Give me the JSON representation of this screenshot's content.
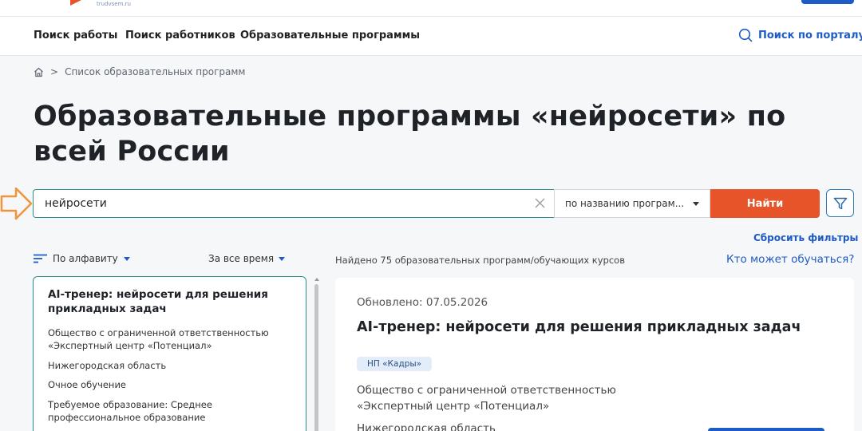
{
  "header": {
    "site_url": "trudvsem.ru",
    "accent_color": "#e8542a",
    "brand_color": "#1e5bc6"
  },
  "nav": {
    "items": [
      {
        "label": "Поиск работы"
      },
      {
        "label": "Поиск работников"
      },
      {
        "label": "Образовательные программы"
      }
    ],
    "search_label": "Поиск по порталу",
    "search_icon": "search-icon"
  },
  "breadcrumb": {
    "home_icon": "home-icon",
    "separator": ">",
    "current": "Список образовательных программ"
  },
  "page_title": "Образовательные программы «нейросети» по всей России",
  "search": {
    "value": "нейросети",
    "mode_selected": "по названию програм...",
    "submit_label": "Найти",
    "filter_icon": "filter-icon"
  },
  "reset_filters": "Сбросить фильтры",
  "sort": {
    "label": "По алфавиту",
    "period": "За все время"
  },
  "results_found": "Найдено 75 образовательных программ/обучающих курсов",
  "who_can_study": "Кто может обучаться?",
  "list_card": {
    "title": "AI-тренер: нейросети для решения прикладных задач",
    "org": "Общество с ограниченной ответственностью «Экспертный центр «Потенциал»",
    "region": "Нижегородская область",
    "form": "Очное обучение",
    "education": "Требуемое образование: Среднее профессиональное образование"
  },
  "detail_card": {
    "updated": "Обновлено: 07.05.2026",
    "title": "AI-тренер: нейросети для решения прикладных задач",
    "tag": "НП «Кадры»",
    "org": "Общество с ограниченной ответственностью «Экспертный центр «Потенциал»",
    "region": "Нижегородская область"
  }
}
